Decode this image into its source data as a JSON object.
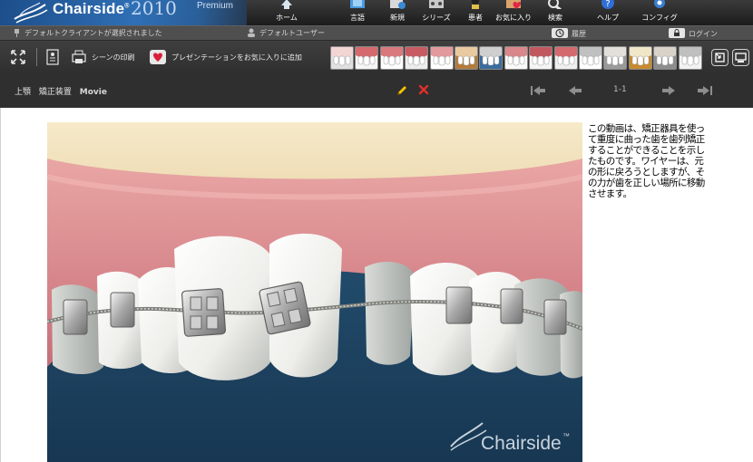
{
  "app": {
    "name": "Chairside",
    "trademark": "®",
    "year": "2010",
    "tier": "Premium"
  },
  "nav": [
    {
      "label": "ホーム",
      "icon": "home-icon"
    },
    {
      "label": "言語",
      "icon": "language-icon"
    },
    {
      "label": "新規",
      "icon": "new-icon"
    },
    {
      "label": "シリーズ",
      "icon": "series-icon"
    },
    {
      "label": "患者",
      "icon": "patient-icon"
    },
    {
      "label": "お気に入り",
      "icon": "favorites-icon"
    },
    {
      "label": "検索",
      "icon": "search-icon"
    },
    {
      "label": "ヘルプ",
      "icon": "help-icon"
    },
    {
      "label": "コンフィグ",
      "icon": "config-icon"
    }
  ],
  "status": {
    "client": "デフォルトクライアントが選択されました",
    "user": "デフォルトユーザー",
    "history": "履歴",
    "login": "ログイン"
  },
  "toolbar": {
    "print_scene": "シーンの印刷",
    "add_favorite": "プレゼンテーションをお気に入りに追加",
    "thumbnail_count": 15
  },
  "titlebar": {
    "crumbs": [
      "上顎",
      "矯正装置",
      "Movie"
    ],
    "page": "1-1"
  },
  "content": {
    "watermark": "Chairside",
    "watermark_tm": "™",
    "description": "この動画は、矯正器具を使って重度に曲った歯を歯列矯正することができることを示したものです。ワイヤーは、元の形に戻ろうとしますが、その力が歯を正しい場所に移動させます。"
  },
  "colors": {
    "brand_blue": "#2f6fb5",
    "gum": "#d98b8e",
    "background_blue": "#1d3f5d",
    "toolbar": "#3a3a3a"
  }
}
